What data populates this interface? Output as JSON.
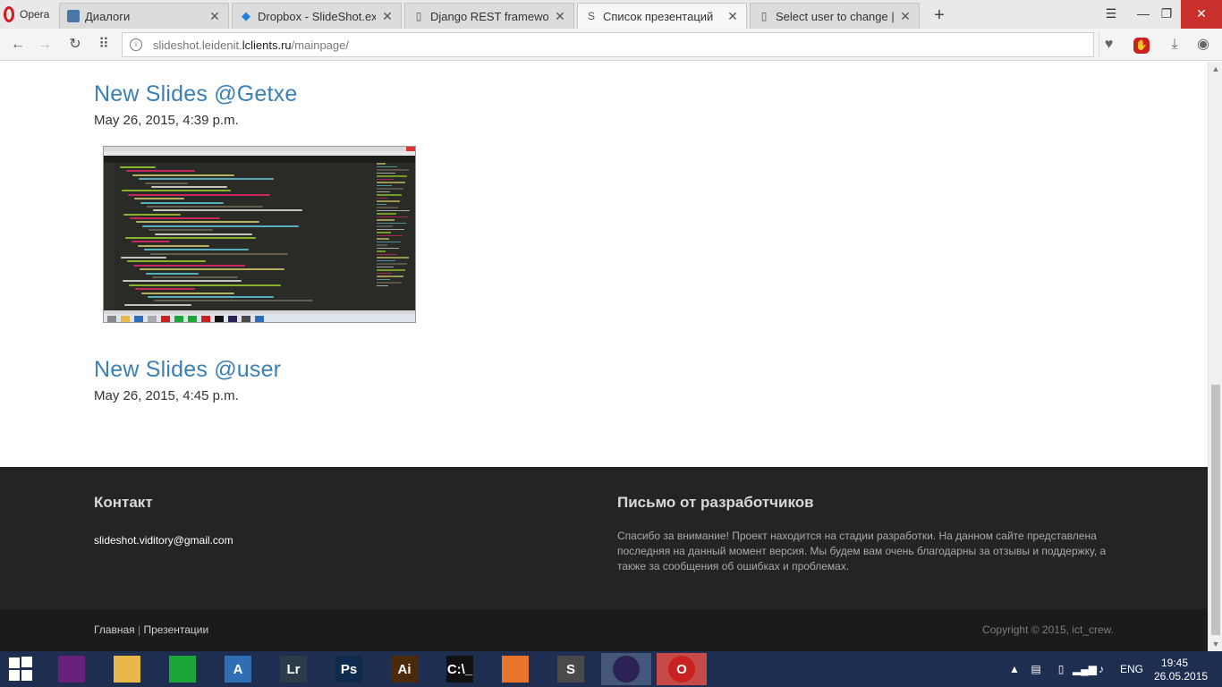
{
  "browser": {
    "menu_label": "Opera",
    "tabs": [
      {
        "title": "Диалоги",
        "icon": "vk-message-icon"
      },
      {
        "title": "Dropbox - SlideShot.exe",
        "icon": "dropbox-icon"
      },
      {
        "title": "Django REST framework",
        "icon": "page-icon"
      },
      {
        "title": "Список презентаций",
        "icon": "site-s-icon",
        "active": true
      },
      {
        "title": "Select user to change | Dja",
        "icon": "page-icon"
      }
    ],
    "new_tab": "+",
    "url": {
      "prefix": "slideshot.leidenit.",
      "domain": "lclients.ru",
      "path": "/mainpage/"
    }
  },
  "posts": [
    {
      "title": "New Slides @Getxe",
      "date": "May 26, 2015, 4:39 p.m."
    },
    {
      "title": "New Slides @user",
      "date": "May 26, 2015, 4:45 p.m."
    }
  ],
  "footer": {
    "contact_heading": "Контакт",
    "contact_email": "slideshot.viditory@gmail.com",
    "dev_heading": "Письмо от разработчиков",
    "dev_text": "Спасибо за внимание! Проект находится на стадии разработки. На данном сайте представлена последняя на данный момент версия. Мы будем вам очень благодарны за отзывы и поддержку, а также за сообщения об ошибках и проблемах.",
    "links": [
      "Главная",
      "Презентации"
    ],
    "link_separator": "|",
    "copyright": "Copyright © 2015, ict_crew."
  },
  "taskbar": {
    "apps": [
      {
        "name": "visual-studio",
        "label": "",
        "color": "#68217a"
      },
      {
        "name": "file-explorer",
        "label": "",
        "color": "#e8b84a"
      },
      {
        "name": "store",
        "label": "",
        "color": "#1aa639"
      },
      {
        "name": "text-editor",
        "label": "A",
        "color": "#2f6db5"
      },
      {
        "name": "lightroom",
        "label": "Lr",
        "color": "#2c3b4a"
      },
      {
        "name": "photoshop",
        "label": "Ps",
        "color": "#0d2b4f"
      },
      {
        "name": "illustrator",
        "label": "Ai",
        "color": "#4a2a0a"
      },
      {
        "name": "command-prompt",
        "label": "C:\\_",
        "color": "#111111"
      },
      {
        "name": "camera-app",
        "label": "",
        "color": "#e8752b"
      },
      {
        "name": "sublime-text",
        "label": "S",
        "color": "#4a4a4a"
      },
      {
        "name": "eclipse",
        "label": "",
        "color": "#2c2255"
      },
      {
        "name": "opera",
        "label": "O",
        "color": "#c8211f"
      }
    ],
    "language": "ENG",
    "time": "19:45",
    "date": "26.05.2015"
  },
  "colors": {
    "link": "#3a7fb5",
    "footer_bg": "#242424",
    "footer_bottom_bg": "#1b1b1b",
    "taskbar_bg": "#1d2e50"
  }
}
